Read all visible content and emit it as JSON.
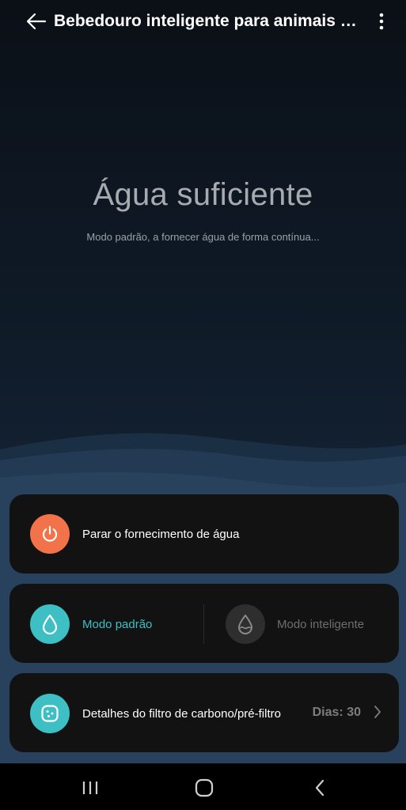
{
  "header": {
    "title": "Bebedouro inteligente para animais de estimação",
    "back_icon": "arrow-left-icon",
    "more_icon": "more-vertical-icon"
  },
  "status": {
    "title": "Água suficiente",
    "subtitle": "Modo padrão, a fornecer água de forma contínua..."
  },
  "power_card": {
    "label": "Parar o fornecimento de água",
    "icon": "power-icon",
    "color": "#f2734a"
  },
  "mode_card": {
    "standard_label": "Modo padrão",
    "standard_icon": "water-drop-icon",
    "standard_color": "#3dbfc4",
    "standard_active": true,
    "smart_label": "Modo inteligente",
    "smart_icon": "smart-drop-icon",
    "smart_active": false
  },
  "filter_card": {
    "label": "Detalhes do filtro de carbono/pré-filtro",
    "days": "Dias: 30",
    "icon": "filter-icon",
    "color": "#3dbfc4"
  },
  "navbar": {
    "recents_icon": "recents-icon",
    "home_icon": "home-icon",
    "back_icon": "nav-back-icon"
  },
  "colors": {
    "accent": "#3dbfc4",
    "warning": "#f2734a",
    "card_bg": "#121212"
  }
}
